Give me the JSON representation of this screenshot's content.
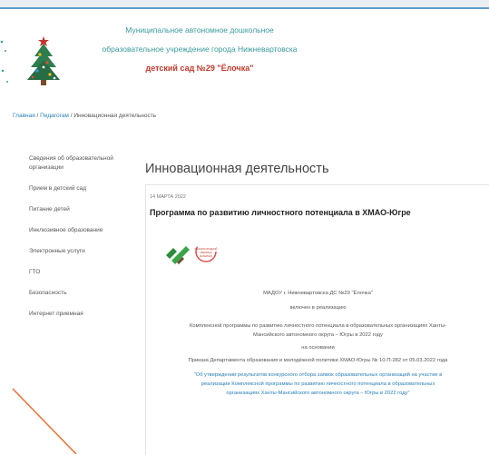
{
  "header": {
    "line1": "Муниципальное автономное дошкольное",
    "line2": "образовательное учреждение города Нижневартовска",
    "line3": "детский сад №29 \"Ёлочка\""
  },
  "breadcrumb": {
    "home": "Главная",
    "sep1": " / ",
    "section": "Педагогам",
    "sep2": " / ",
    "current": "Инновационная деятельность"
  },
  "sidebar": {
    "items": [
      "Сведения об образовательной организации",
      "Прием в детский сад",
      "Питание детей",
      "Инклюзивное образование",
      "Электронные услуги",
      "ГТО",
      "Безопасность",
      "Интернет приемная"
    ]
  },
  "page": {
    "title": "Инновационная деятельность"
  },
  "article": {
    "date": "14 МАРТА 2022",
    "title": "Программа по развитию личностного потенциала в ХМАО-Югре",
    "logo_text": "МЕЖДУНАРОДНЫЙ СБЕРБАНК МАТЕРИАЛ",
    "p1": "МАДОУ г. Нижневартовска ДС №29 \"Ёлочка\"",
    "p2": "включен в реализацию",
    "p3": "Комплексной программы по развитию личностного потенциала в образовательных организациях Ханты-",
    "p4": "Мансийского автономного округа – Югры в 2022 году",
    "p5": "на основании",
    "p6": "Приказа Департамента образования и молодёжной политики ХМАО-Югры № 10-П-282 от 05.03.2022 года",
    "p7": "\"Об утверждении результатов конкурсного отбора заявок образовательных организаций на участие в",
    "p8": "реализации Комплексной программы по развитию личностного потенциала в образовательных",
    "p9": "организациях Ханты-Мансийского автономного округа – Югры в 2022 году\""
  },
  "colors": {
    "accent": "#3a9a9a",
    "title_red": "#c0392b",
    "link": "#2a7fb8",
    "orange_line": "#e8743b"
  }
}
